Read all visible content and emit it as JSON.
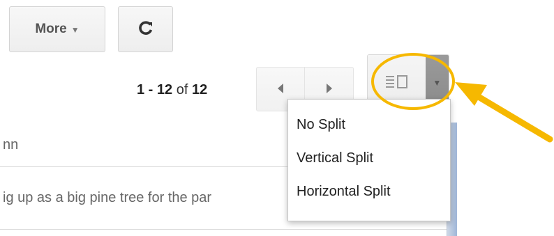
{
  "toolbar": {
    "more_label": "More",
    "more_caret": "▼",
    "refresh_glyph": "C",
    "refresh_icon": "refresh-icon"
  },
  "pager": {
    "range": "1 - 12",
    "of_label": "of",
    "total": "12",
    "prev_icon": "chevron-left-icon",
    "next_icon": "chevron-right-icon"
  },
  "split_toggle": {
    "icon": "split-pane-icon",
    "arrow_icon": "caret-down-icon",
    "arrow_glyph": "▼"
  },
  "menu": {
    "items": [
      {
        "label": "No Split"
      },
      {
        "label": "Vertical Split"
      },
      {
        "label": "Horizontal Split"
      }
    ]
  },
  "emails": [
    {
      "snippet": "nn"
    },
    {
      "snippet": "ig up as a big pine tree for the par"
    }
  ],
  "annotation": {
    "ring_color": "#f6b800",
    "arrow_color": "#f6b800"
  }
}
